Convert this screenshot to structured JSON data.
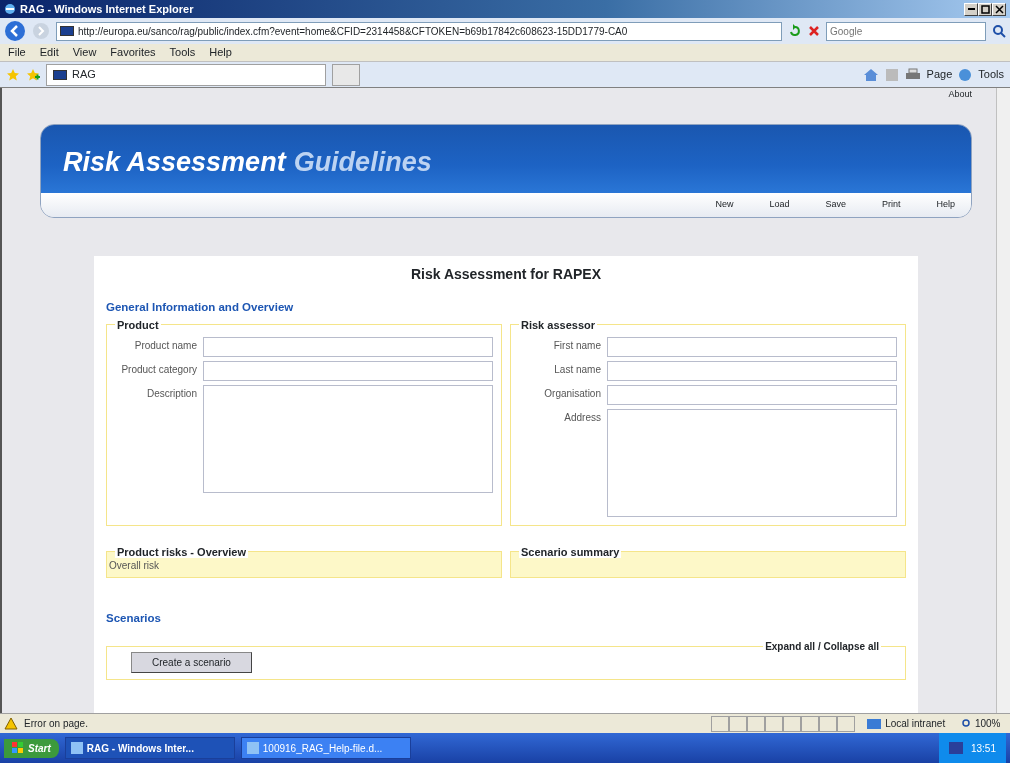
{
  "window": {
    "title": "RAG - Windows Internet Explorer"
  },
  "address_bar": {
    "url": "http://europa.eu/sanco/rag/public/index.cfm?event=home&CFID=2314458&CFTOKEN=b69b17842c608623-15DD1779-CA0"
  },
  "search": {
    "placeholder": "Google"
  },
  "menu": [
    "File",
    "Edit",
    "View",
    "Favorites",
    "Tools",
    "Help"
  ],
  "tabs": [
    {
      "label": "RAG",
      "selected": true
    }
  ],
  "command_bar": [
    "Page",
    "Tools"
  ],
  "page": {
    "about_link": "About",
    "banner": {
      "title": "Risk Assessment",
      "highlight": "Guidelines"
    },
    "nav": [
      "New",
      "Load",
      "Save",
      "Print",
      "Help"
    ],
    "form_title": "Risk Assessment for RAPEX",
    "section_heading": "General Information and Overview",
    "fieldsets": [
      {
        "legend": "Product",
        "fields": [
          {
            "label": "Product name",
            "kind": "input"
          },
          {
            "label": "Product category",
            "kind": "input"
          },
          {
            "label": "Description",
            "kind": "textarea"
          }
        ]
      },
      {
        "legend": "Risk assessor",
        "fields": [
          {
            "label": "First name",
            "kind": "input"
          },
          {
            "label": "Last name",
            "kind": "input"
          },
          {
            "label": "Organisation",
            "kind": "input"
          },
          {
            "label": "Address",
            "kind": "textarea"
          }
        ]
      }
    ],
    "overview": [
      {
        "legend": "Product risks - Overview",
        "text": "Overall risk"
      },
      {
        "legend": "Scenario summary"
      }
    ],
    "scenarios": {
      "heading": "Scenarios",
      "expand_link": "Expand all",
      "separator": "/",
      "collapse_link": "Collapse all",
      "button": "Create a scenario"
    }
  },
  "status_bar": {
    "message": "Error on page.",
    "zone": "Local intranet",
    "zoom": "100%"
  },
  "taskbar": {
    "start": "Start",
    "items": [
      {
        "label": "RAG - Windows Inter...",
        "selected": true
      },
      {
        "label": "100916_RAG_Help-file.d...",
        "selected": false
      }
    ],
    "clock": "13:51"
  }
}
